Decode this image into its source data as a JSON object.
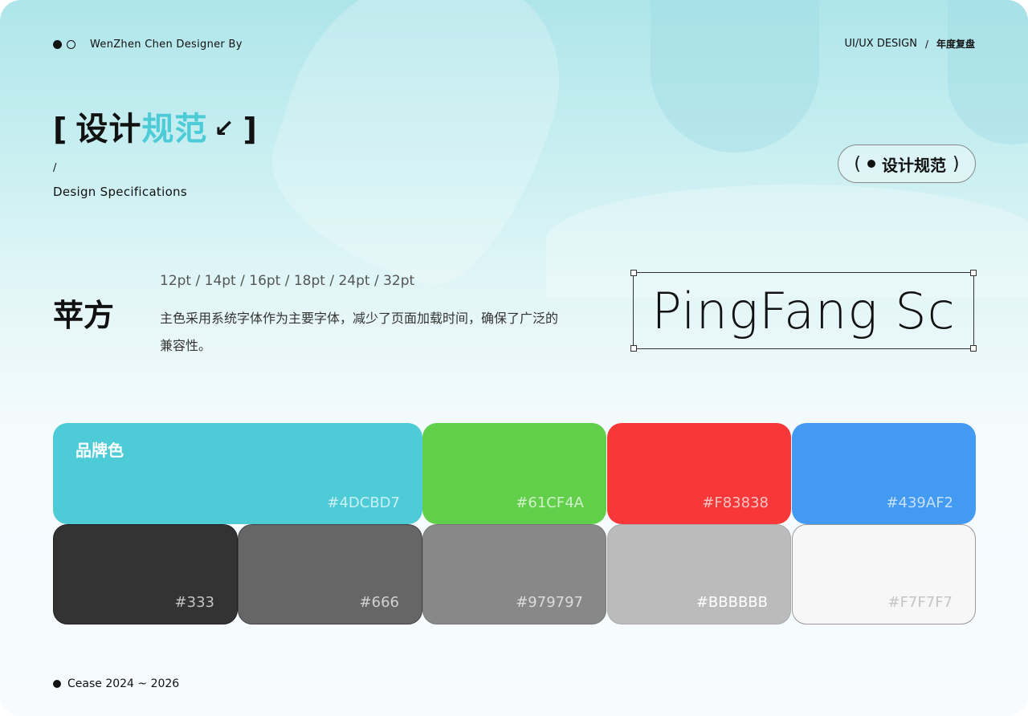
{
  "header": {
    "designer": "WenZhen Chen Designer By",
    "section": "UI/UX DESIGN",
    "separator": "/",
    "year_review": "年度复盘"
  },
  "title": {
    "open_bracket": "[",
    "plain": "设计",
    "accent": "规范",
    "arrow": "↙",
    "close_bracket": "]",
    "slash": "/",
    "subtitle": "Design Specifications"
  },
  "pill": {
    "open": "(",
    "label": "设计规范",
    "close": ")"
  },
  "font": {
    "name": "苹方",
    "sizes": "12pt / 14pt / 16pt / 18pt / 24pt / 32pt",
    "description": "主色采用系统字体作为主要字体，减少了页面加载时间，确保了广泛的兼容性。",
    "sample": "PingFang Sc"
  },
  "colors": {
    "brand_label": "品牌色",
    "row1": [
      {
        "hex": "#4DCBD7",
        "color": "#4dcbd7"
      },
      {
        "hex": "#61CF4A",
        "color": "#61cf4a"
      },
      {
        "hex": "#F83838",
        "color": "#f83838"
      },
      {
        "hex": "#439AF2",
        "color": "#439af2"
      }
    ],
    "row2": [
      {
        "hex": "#333",
        "color": "#333333"
      },
      {
        "hex": "#666",
        "color": "#666666"
      },
      {
        "hex": "#979797",
        "color": "#888888"
      },
      {
        "hex": "#BBBBBB",
        "color": "#bbbbbb"
      },
      {
        "hex": "#F7F7F7",
        "color": "#f7f7f7"
      }
    ]
  },
  "footer": {
    "text": "Cease 2024 ~ 2026"
  }
}
